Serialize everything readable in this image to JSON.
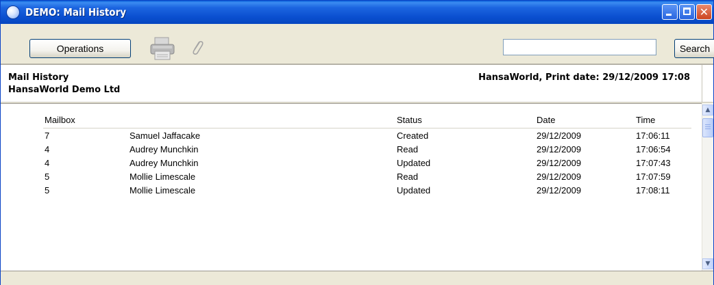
{
  "window": {
    "title": "DEMO: Mail History"
  },
  "toolbar": {
    "operations_label": "Operations",
    "search_value": "",
    "search_label": "Search"
  },
  "report": {
    "title": "Mail History",
    "company": "HansaWorld Demo Ltd",
    "print_info": "HansaWorld, Print date: 29/12/2009 17:08"
  },
  "columns": {
    "mailbox": "Mailbox",
    "status": "Status",
    "date": "Date",
    "time": "Time"
  },
  "rows": [
    {
      "mailbox": "7",
      "name": "Samuel Jaffacake",
      "status": "Created",
      "date": "29/12/2009",
      "time": "17:06:11"
    },
    {
      "mailbox": "4",
      "name": "Audrey Munchkin",
      "status": "Read",
      "date": "29/12/2009",
      "time": "17:06:54"
    },
    {
      "mailbox": "4",
      "name": "Audrey Munchkin",
      "status": "Updated",
      "date": "29/12/2009",
      "time": "17:07:43"
    },
    {
      "mailbox": "5",
      "name": "Mollie Limescale",
      "status": "Read",
      "date": "29/12/2009",
      "time": "17:07:59"
    },
    {
      "mailbox": "5",
      "name": "Mollie Limescale",
      "status": "Updated",
      "date": "29/12/2009",
      "time": "17:08:11"
    }
  ],
  "icons": {
    "app": "hansaworld-app-icon",
    "print": "printer-icon",
    "attach": "paperclip-icon",
    "minimize": "minimize-icon",
    "maximize": "maximize-icon",
    "close": "close-icon",
    "scroll_up": "chevron-up-icon",
    "scroll_down": "chevron-down-icon"
  },
  "colors": {
    "titlebar": "#0a4fd0",
    "close_button": "#cc4420",
    "window_bg": "#ece9d8"
  }
}
